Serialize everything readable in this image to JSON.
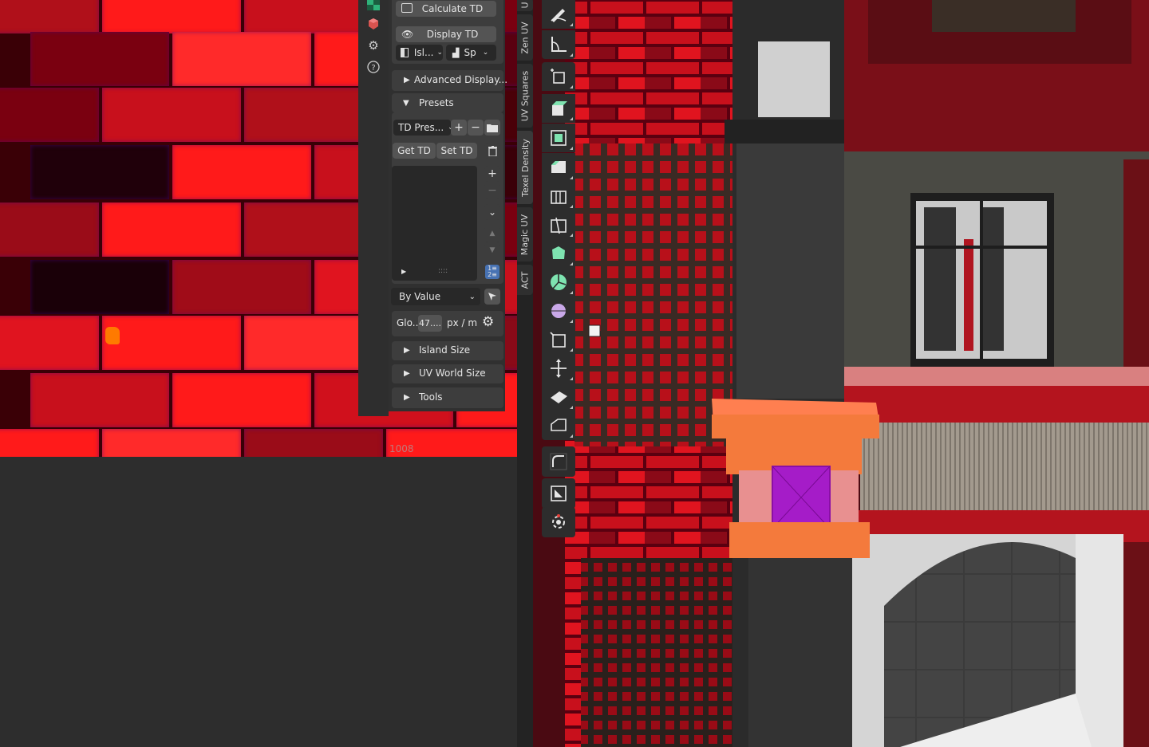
{
  "uv_editor": {
    "coordinate_label": "1008"
  },
  "side_icons": [
    "checker-icon",
    "object-icon",
    "gear-icon",
    "help-icon"
  ],
  "texel_panel": {
    "calculate_td": "Calculate TD",
    "display_td": "Display TD",
    "island_select": "Isl...",
    "spectrum_select": "Sp",
    "advanced_display": "Advanced Display...",
    "presets": "Presets",
    "td_presets_select": "TD Pres...",
    "add_preset": "+",
    "remove_preset": "−",
    "get_td": "Get TD",
    "set_td": "Set TD",
    "list_add": "+",
    "list_remove": "−",
    "list_grip": "::::",
    "by_value_select": "By Value",
    "global_label": "Glo...",
    "td_value": "47....",
    "units": "px / m",
    "island_size": "Island Size",
    "uv_world_size": "UV World Size",
    "tools": "Tools"
  },
  "tabs": [
    {
      "label": "U"
    },
    {
      "label": "Zen UV"
    },
    {
      "label": "UV Squares"
    },
    {
      "label": "Texel Density"
    },
    {
      "label": "Magic UV"
    },
    {
      "label": "ACT"
    }
  ],
  "toolbar": {
    "tools": [
      {
        "name": "annotate-tool-icon"
      },
      {
        "name": "measure-tool-icon"
      },
      {
        "name": "add-cube-tool-icon"
      },
      {
        "name": "extrude-region-tool-icon"
      },
      {
        "name": "inset-faces-tool-icon"
      },
      {
        "name": "bevel-tool-icon"
      },
      {
        "name": "loop-cut-tool-icon"
      },
      {
        "name": "knife-tool-icon"
      },
      {
        "name": "poly-build-tool-icon"
      },
      {
        "name": "spin-tool-icon"
      },
      {
        "name": "smooth-tool-icon"
      },
      {
        "name": "edge-slide-tool-icon"
      },
      {
        "name": "shrink-fatten-tool-icon"
      },
      {
        "name": "shear-tool-icon"
      },
      {
        "name": "rip-region-tool-icon"
      },
      {
        "name": "transform-gizmo-icon"
      },
      {
        "name": "transform-tool-icon"
      },
      {
        "name": "cursor-tool-icon"
      }
    ]
  },
  "colors": {
    "accent": "#4772b3",
    "brick_bright": "#ff1a1a",
    "brick_dark": "#6a0010",
    "selection_orange": "#ff7a00",
    "selection_face": "#a51cc8"
  }
}
